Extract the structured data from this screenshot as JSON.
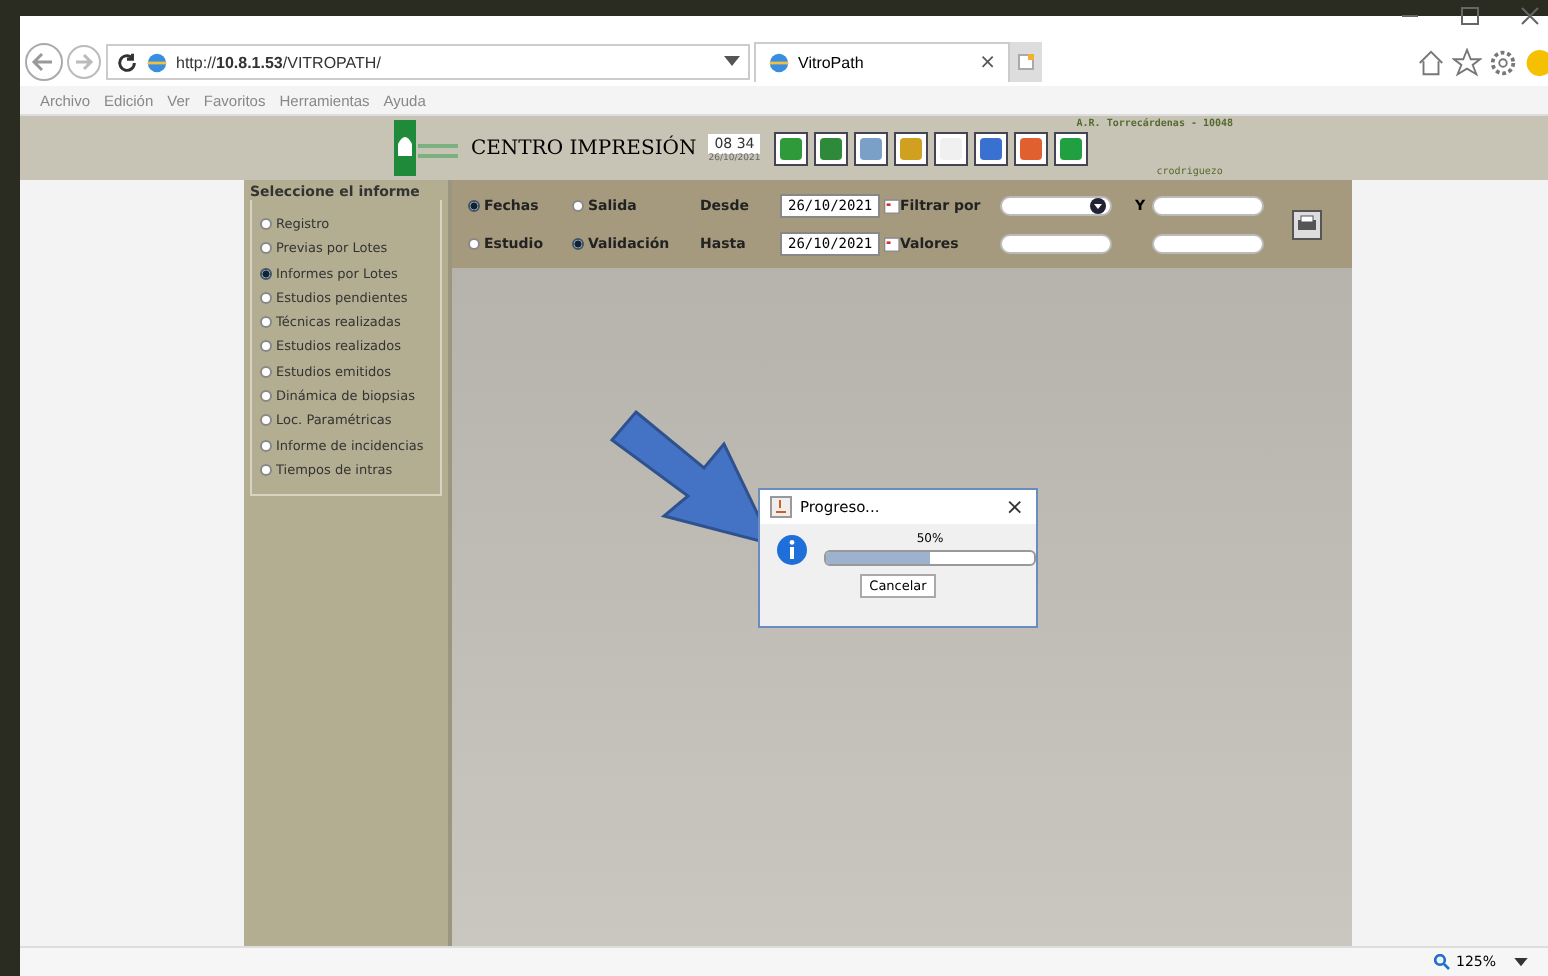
{
  "browser": {
    "address": "http://**10.8.1.53**/VITROPATH/",
    "tab": {
      "title": "VitroPath",
      "close": "×"
    },
    "menu": [
      "Archivo",
      "Edición",
      "Ver",
      "Favoritos",
      "Herramientas",
      "Ayuda"
    ],
    "zoom": "125%"
  },
  "header": {
    "title": "CENTRO IMPRESIÓN",
    "time": "08 34",
    "date": "26/10/2021",
    "center": "A.R. Torrecárdenas - 10048",
    "user": "crodriguezo"
  },
  "sidebar": {
    "title": "Seleccione el informe",
    "items": [
      {
        "label": "Registro",
        "selected": false
      },
      {
        "label": "Previas por Lotes",
        "selected": false
      },
      {
        "label": "Informes por Lotes",
        "selected": true
      },
      {
        "label": "Estudios pendientes",
        "selected": false
      },
      {
        "label": "Técnicas realizadas",
        "selected": false
      },
      {
        "label": "Estudios realizados",
        "selected": false
      },
      {
        "label": "Estudios emitidos",
        "selected": false
      },
      {
        "label": "Dinámica de biopsias",
        "selected": false
      },
      {
        "label": "Loc. Paramétricas",
        "selected": false
      },
      {
        "label": "Informe de incidencias",
        "selected": false
      },
      {
        "label": "Tiempos de intras",
        "selected": false
      }
    ]
  },
  "filters": {
    "rows": [
      {
        "radios": [
          {
            "label": "Fechas",
            "selected": true
          },
          {
            "label": "Salida",
            "selected": false
          }
        ],
        "date_label": "Desde",
        "date": "26/10/2021",
        "filter_label": "Filtrar por"
      },
      {
        "radios": [
          {
            "label": "Estudio",
            "selected": false
          },
          {
            "label": "Validación",
            "selected": true
          }
        ],
        "date_label": "Hasta",
        "date": "26/10/2021",
        "filter_label": "Valores"
      }
    ],
    "and_label": "Y"
  },
  "dialog": {
    "title": "Progreso...",
    "close": "×",
    "percent": "50%",
    "level": 0.5,
    "button": "Cancelar"
  }
}
